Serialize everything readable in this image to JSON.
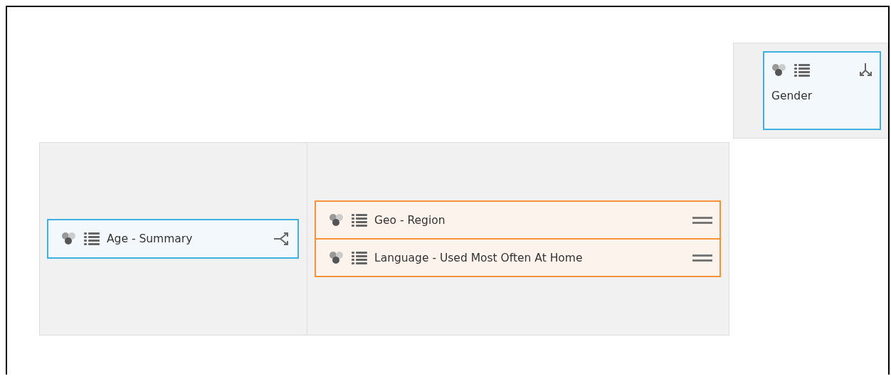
{
  "top_zone": {
    "items": [
      {
        "label": "Gender",
        "kind": "column"
      }
    ]
  },
  "grid": {
    "cells": [
      {
        "items": [
          {
            "label": "Age - Summary",
            "kind": "row"
          }
        ]
      },
      {
        "items": [
          {
            "label": "Geo - Region",
            "kind": "filter"
          },
          {
            "label": "Language - Used Most Often At Home",
            "kind": "filter"
          }
        ]
      }
    ]
  }
}
